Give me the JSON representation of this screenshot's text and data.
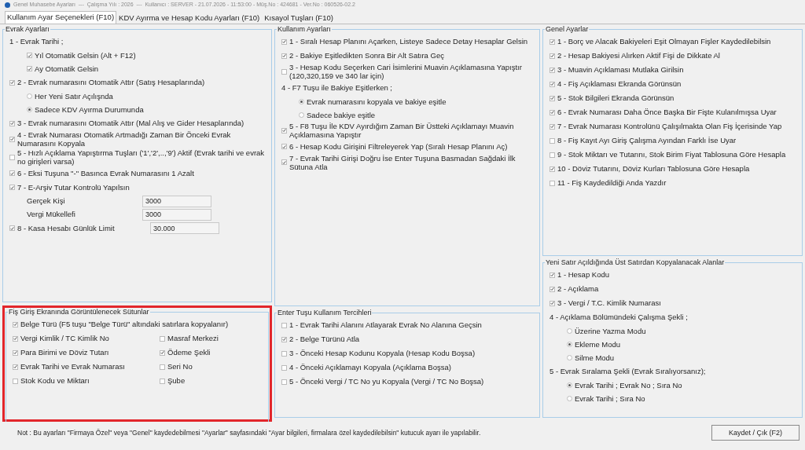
{
  "window": {
    "title": "Genel Muhasebe Ayarları  ---  Çalışma Yılı : 2026  ---  Kullanıcı : SERVER - 21.07.2026 - 11:53:00 - Müş.No : 424681 - Ver.No : 060526-02.2"
  },
  "tabs": [
    {
      "label": "Kullanım Ayar Seçenekleri (F10)",
      "selected": true
    },
    {
      "label": "KDV Ayırma ve Hesap Kodu Ayarları (F10)",
      "selected": false
    },
    {
      "label": "Kısayol Tuşları (F10)",
      "selected": false
    }
  ],
  "columns": [
    {
      "panels": [
        {
          "title": "Evrak Ayarları",
          "highlighted": false,
          "items": [
            {
              "kind": "text",
              "label": "1 - Evrak Tarihi ;",
              "children": [
                {
                  "kind": "check",
                  "label": "Yıl Otomatik Gelsin (Alt + F12)",
                  "checked": true
                },
                {
                  "kind": "check",
                  "label": "Ay Otomatik Gelsin",
                  "checked": true
                }
              ]
            },
            {
              "kind": "check",
              "label": "2 - Evrak numarasını Otomatik Attır (Satış Hesaplarında)",
              "checked": true,
              "children": [
                {
                  "kind": "radio",
                  "label": "Her Yeni Satır Açılışnda",
                  "selected": false
                },
                {
                  "kind": "radio",
                  "label": "Sadece KDV Ayırma Durumunda",
                  "selected": true
                }
              ]
            },
            {
              "kind": "check",
              "label": "3 - Evrak numarasını Otomatik Attır (Mal Alış ve Gider Hesaplarında)",
              "checked": true
            },
            {
              "kind": "check",
              "label": "4 - Evrak Numarası Otomatik Artmadığı Zaman Bir Önceki Evrak Numarasını Kopyala",
              "checked": true
            },
            {
              "kind": "check",
              "label": "5 - Hızlı Açıklama Yapıştırma Tuşları ('1','2',..,'9') Aktif (Evrak tarihi ve evrak no girişleri varsa)",
              "checked": false
            },
            {
              "kind": "check",
              "label": "6 - Eksi Tuşuna \"-\" Basınca Evrak Numarasını 1 Azalt",
              "checked": true
            },
            {
              "kind": "check",
              "label": "7 - E-Arşiv Tutar Kontrolü Yapılsın",
              "checked": true,
              "children": [
                {
                  "kind": "field",
                  "label": "Gerçek Kişi",
                  "value": "3000"
                },
                {
                  "kind": "field",
                  "label": "Vergi Mükellefi",
                  "value": "3000"
                }
              ]
            },
            {
              "kind": "check_field",
              "label": "8 - Kasa Hesabı Günlük Limit",
              "checked": true,
              "value": "30.000"
            }
          ]
        },
        {
          "title": "Fiş Giriş Ekranında Görüntülenecek Sütunlar",
          "highlighted": true,
          "items": [
            {
              "kind": "check",
              "label": "Belge Türü (F5 tuşu \"Belge Türü\" altındaki satırlara kopyalanır)",
              "checked": true
            },
            {
              "kind": "pair",
              "cells": [
                {
                  "kind": "check",
                  "label": "Vergi Kimlik / TC Kimlik No",
                  "checked": true
                },
                {
                  "kind": "check",
                  "label": "Masraf Merkezi",
                  "checked": false
                }
              ]
            },
            {
              "kind": "pair",
              "cells": [
                {
                  "kind": "check",
                  "label": "Para Birimi ve Döviz Tutarı",
                  "checked": true
                },
                {
                  "kind": "check",
                  "label": "Ödeme Şekli",
                  "checked": true
                }
              ]
            },
            {
              "kind": "pair",
              "cells": [
                {
                  "kind": "check",
                  "label": "Evrak Tarihi ve Evrak Numarası",
                  "checked": true
                },
                {
                  "kind": "check",
                  "label": "Seri No",
                  "checked": false
                }
              ]
            },
            {
              "kind": "pair",
              "cells": [
                {
                  "kind": "check",
                  "label": "Stok Kodu ve Miktarı",
                  "checked": false
                },
                {
                  "kind": "check",
                  "label": "Şube",
                  "checked": false
                }
              ]
            }
          ]
        }
      ]
    },
    {
      "panels": [
        {
          "title": "Kullanım Ayarları",
          "highlighted": false,
          "items": [
            {
              "kind": "check",
              "label": "1 -  Sıralı Hesap Planını Açarken, Listeye Sadece Detay Hesaplar Gelsin",
              "checked": true
            },
            {
              "kind": "check",
              "label": "2 - Bakiye Eşitledikten Sonra Bir Alt Satıra Geç",
              "checked": true
            },
            {
              "kind": "check",
              "label": "3 - Hesap Kodu Seçerken Cari İsimlerini Muavin Açıklamasına Yapıştır (120,320,159 ve 340 lar için)",
              "checked": false
            },
            {
              "kind": "text",
              "label": "4 - F7 Tuşu ile Bakiye Eşitlerken ;",
              "children": [
                {
                  "kind": "radio",
                  "label": "Evrak numarasını kopyala ve bakiye eşitle",
                  "selected": true
                },
                {
                  "kind": "radio",
                  "label": "Sadece bakiye eşitle",
                  "selected": false
                }
              ]
            },
            {
              "kind": "check",
              "label": "5 - F8 Tuşu İle KDV Ayırdığım Zaman Bir Üstteki Açıklamayı Muavin Açıklamasına Yapıştır",
              "checked": true
            },
            {
              "kind": "check",
              "label": "6 - Hesap Kodu Girişini Filtreleyerek Yap (Sıralı Hesap Planını Aç)",
              "checked": true
            },
            {
              "kind": "check",
              "label": "7 - Evrak Tarihi Girişi Doğru İse Enter Tuşuna Basmadan Sağdaki İlk Sütuna Atla",
              "checked": true
            }
          ]
        },
        {
          "title": "Enter Tuşu Kullanım Tercihleri",
          "highlighted": false,
          "items": [
            {
              "kind": "check",
              "label": "1 - Evrak Tarihi Alanını Atlayarak Evrak No Alanına Geçsin",
              "checked": false
            },
            {
              "kind": "check",
              "label": "2 - Belge Türünü Atla",
              "checked": true
            },
            {
              "kind": "check",
              "label": "3 - Önceki Hesap Kodunu Kopyala (Hesap Kodu Boşsa)",
              "checked": false
            },
            {
              "kind": "check",
              "label": "4 -  Önceki Açıklamayı Kopyala (Açıklama Boşsa)",
              "checked": false
            },
            {
              "kind": "check",
              "label": "5 - Önceki Vergi / TC No yu Kopyala (Vergi / TC No Boşsa)",
              "checked": false
            }
          ]
        }
      ]
    },
    {
      "panels": [
        {
          "title": "Genel Ayarlar",
          "highlighted": false,
          "items": [
            {
              "kind": "check",
              "label": "1 - Borç ve Alacak Bakiyeleri Eşit Olmayan Fişler Kaydedilebilsin",
              "checked": true
            },
            {
              "kind": "check",
              "label": "2 - Hesap Bakiyesi Alırken Aktif Fişi de Dikkate Al",
              "checked": true
            },
            {
              "kind": "check",
              "label": "3 - Muavin Açıklaması Mutlaka Girilsin",
              "checked": true
            },
            {
              "kind": "check",
              "label": "4 - Fiş Açıklaması Ekranda Görünsün",
              "checked": true
            },
            {
              "kind": "check",
              "label": "5 - Stok Bilgileri Ekranda Görünsün",
              "checked": true
            },
            {
              "kind": "check",
              "label": "6 - Evrak Numarası Daha Önce Başka Bir Fişte Kulanılmışsa Uyar",
              "checked": true
            },
            {
              "kind": "check",
              "label": "7 - Evrak Numarası Kontrolünü Çalışılmakta Olan Fiş İçerisinde Yap",
              "checked": true
            },
            {
              "kind": "check",
              "label": "8 - Fiş Kayıt Ayı Giriş Çalışma Ayından Farklı İse Uyar",
              "checked": false
            },
            {
              "kind": "check",
              "label": "9 - Stok Miktarı ve Tutarını, Stok Birim Fiyat Tablosuna Göre Hesapla",
              "checked": false
            },
            {
              "kind": "check",
              "label": "10 - Döviz Tutarını, Döviz Kurları Tablosuna Göre Hesapla",
              "checked": true
            },
            {
              "kind": "check",
              "label": "11 - Fiş Kaydedildiği Anda Yazdır",
              "checked": false
            }
          ]
        },
        {
          "title": "Yeni Satır Açıldığında Üst Satırdan Kopyalanacak Alanlar",
          "highlighted": false,
          "items": [
            {
              "kind": "check",
              "label": "1 - Hesap Kodu",
              "checked": true
            },
            {
              "kind": "check",
              "label": "2 - Açıklama",
              "checked": true
            },
            {
              "kind": "check",
              "label": "3 - Vergi / T.C. Kimlik Numarası",
              "checked": true
            },
            {
              "kind": "text",
              "label": "4 - Açıklama Bölümündeki Çalışma Şekli ;",
              "children": [
                {
                  "kind": "radio",
                  "label": "Üzerine Yazma Modu",
                  "selected": false
                },
                {
                  "kind": "radio",
                  "label": "Ekleme Modu",
                  "selected": true
                },
                {
                  "kind": "radio",
                  "label": "Silme Modu",
                  "selected": false
                }
              ]
            },
            {
              "kind": "text",
              "label": "5 - Evrak Sıralama Şekli (Evrak Sıralıyorsanız);",
              "children": [
                {
                  "kind": "radio",
                  "label": "Evrak Tarihi ; Evrak No ; Sıra No",
                  "selected": true
                },
                {
                  "kind": "radio",
                  "label": "Evrak Tarihi ; Sıra No",
                  "selected": false
                }
              ]
            }
          ]
        }
      ]
    }
  ],
  "footer": {
    "note": "Not : Bu ayarları \"Firmaya Özel\" veya \"Genel\" kaydedebilmesi \"Ayarlar\" sayfasındaki \"Ayar bilgileri, firmalara özel kaydedilebilsin\" kutucuk ayarı ile yapılabilir.",
    "button": "Kaydet / Çık (F2)"
  }
}
